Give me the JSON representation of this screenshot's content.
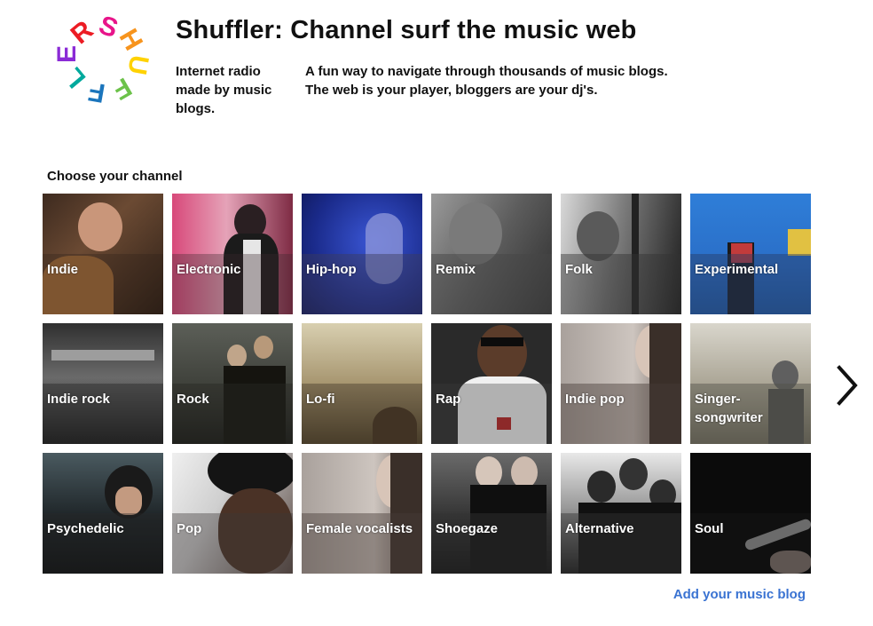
{
  "header": {
    "title": "Shuffler: Channel surf the music web",
    "tagline": "Internet radio made by music blogs.",
    "description_line1": "A fun way to navigate through thousands of music blogs.",
    "description_line2": "The web is your player, bloggers are your dj's."
  },
  "logo": {
    "letters": [
      "S",
      "H",
      "U",
      "F",
      "F",
      "L",
      "E",
      "R"
    ]
  },
  "channels": {
    "heading": "Choose your channel",
    "items": [
      {
        "label": "Indie"
      },
      {
        "label": "Electronic"
      },
      {
        "label": "Hip-hop"
      },
      {
        "label": "Remix"
      },
      {
        "label": "Folk"
      },
      {
        "label": "Experimental"
      },
      {
        "label": "Indie rock"
      },
      {
        "label": "Rock"
      },
      {
        "label": "Lo-fi"
      },
      {
        "label": "Rap"
      },
      {
        "label": "Indie pop"
      },
      {
        "label": "Singer-songwriter"
      },
      {
        "label": "Psychedelic"
      },
      {
        "label": "Pop"
      },
      {
        "label": "Female vocalists"
      },
      {
        "label": "Shoegaze"
      },
      {
        "label": "Alternative"
      },
      {
        "label": "Soul"
      }
    ]
  },
  "icons": {
    "next": "chevron-right-icon"
  },
  "footer": {
    "add_blog_link": "Add your music blog"
  },
  "colors": {
    "link": "#3a73d2",
    "overlay": "#464646",
    "logo": [
      "#e8158a",
      "#f7941d",
      "#ffd200",
      "#6cc24a",
      "#1b75bc",
      "#8b2bd6",
      "#00a99d",
      "#ec1c24"
    ]
  }
}
